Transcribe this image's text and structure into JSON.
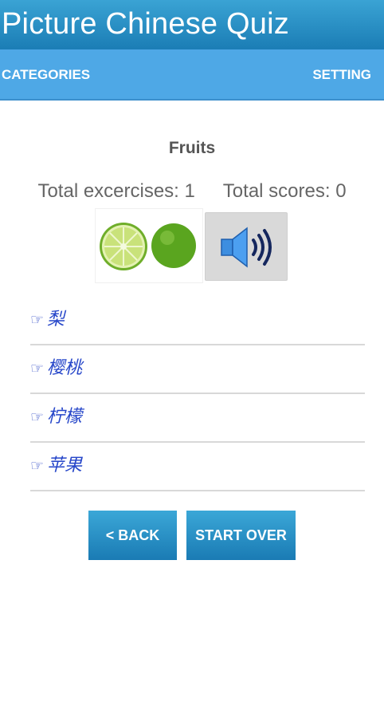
{
  "app": {
    "title": "Picture Chinese Quiz"
  },
  "nav": {
    "categories": "CATEGORIES",
    "setting": "SETTING"
  },
  "quiz": {
    "category": "Fruits",
    "exercises_label": "Total excercises:",
    "exercises": "1",
    "scores_label": "Total scores:",
    "scores": "0",
    "picture_icon": "lime-picture",
    "sound_icon": "speaker-icon",
    "options": [
      {
        "icon": "pointing-hand-icon",
        "hand": "☞",
        "text": "梨"
      },
      {
        "icon": "pointing-hand-icon",
        "hand": "☞",
        "text": "樱桃"
      },
      {
        "icon": "pointing-hand-icon",
        "hand": "☞",
        "text": "柠檬"
      },
      {
        "icon": "pointing-hand-icon",
        "hand": "☞",
        "text": "苹果"
      }
    ]
  },
  "buttons": {
    "back": "< BACK",
    "start_over": "START OVER"
  },
  "colors": {
    "title_bar": "#2a90c6",
    "nav_bar": "#4ea8e6",
    "option_text": "#2646c9",
    "button": "#2a90c6"
  }
}
